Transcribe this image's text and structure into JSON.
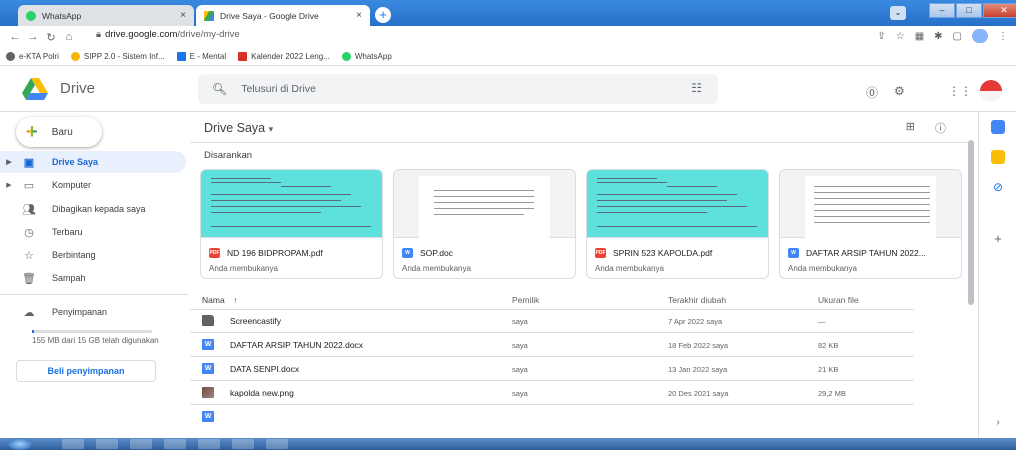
{
  "browser": {
    "tabs": [
      {
        "title": "WhatsApp",
        "close": "×"
      },
      {
        "title": "Drive Saya - Google Drive",
        "close": "×"
      }
    ],
    "new_tab": "+",
    "url_host": "drive.google.com",
    "url_path": "/drive/my-drive",
    "bookmarks": [
      {
        "label": "e-KTA Polri"
      },
      {
        "label": "SIPP 2.0 - Sistem Inf..."
      },
      {
        "label": "E - Mental"
      },
      {
        "label": "Kalender 2022 Leng..."
      },
      {
        "label": "WhatsApp"
      }
    ]
  },
  "header": {
    "app_name": "Drive",
    "search_placeholder": "Telusuri di Drive"
  },
  "sidebar": {
    "new_label": "Baru",
    "items": [
      {
        "label": "Drive Saya",
        "selected": true
      },
      {
        "label": "Komputer"
      },
      {
        "label": "Dibagikan kepada saya"
      },
      {
        "label": "Terbaru"
      },
      {
        "label": "Berbintang"
      },
      {
        "label": "Sampah"
      },
      {
        "label": "Penyimpanan"
      }
    ],
    "storage_text": "155 MB dari 15 GB telah digunakan",
    "storage_used_fraction": 0.01,
    "buy_label": "Beli penyimpanan"
  },
  "main": {
    "title": "Drive Saya",
    "suggested_label": "Disarankan",
    "cards": [
      {
        "name": "ND 196 BIDPROPAM.pdf",
        "sub": "Anda membukanya",
        "type": "PDF"
      },
      {
        "name": "SOP.doc",
        "sub": "Anda membukanya",
        "type": "W"
      },
      {
        "name": "SPRIN 523 KAPOLDA.pdf",
        "sub": "Anda membukanya",
        "type": "PDF"
      },
      {
        "name": "DAFTAR ARSIP TAHUN 2022...",
        "sub": "Anda membukanya",
        "type": "W"
      }
    ],
    "columns": {
      "name": "Nama",
      "sort_arrow": "↑",
      "owner": "Pemilik",
      "modified": "Terakhir diubah",
      "size": "Ukuran file"
    },
    "rows": [
      {
        "name": "Screencastify",
        "owner": "saya",
        "modified": "7 Apr 2022 saya",
        "size": "—"
      },
      {
        "name": "DAFTAR ARSIP TAHUN 2022.docx",
        "owner": "saya",
        "modified": "18 Feb 2022 saya",
        "size": "82 KB"
      },
      {
        "name": "DATA SENPI.docx",
        "owner": "saya",
        "modified": "13 Jan 2022 saya",
        "size": "21 KB"
      },
      {
        "name": "kapolda new.png",
        "owner": "saya",
        "modified": "20 Des 2021 saya",
        "size": "29,2 MB"
      }
    ]
  },
  "colors": {
    "accent": "#1a73e8",
    "selected_bg": "#e8f0fe",
    "pdf": "#ea4335",
    "doc": "#4285f4",
    "thumb_cyan": "#5ee1dd"
  }
}
